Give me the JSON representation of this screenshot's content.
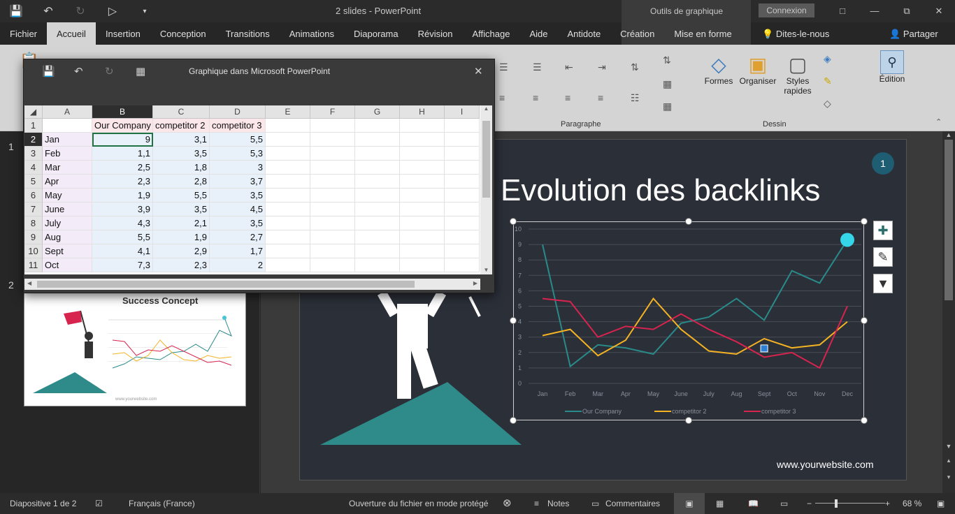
{
  "app": {
    "title": "2 slides  -  PowerPoint",
    "contextual_label": "Outils de graphique",
    "signin_label": "Connexion",
    "tell_me": "Dites-le-nous",
    "share_label": "Partager"
  },
  "tabs": [
    "Fichier",
    "Accueil",
    "Insertion",
    "Conception",
    "Transitions",
    "Animations",
    "Diaporama",
    "Révision",
    "Affichage",
    "Aide",
    "Antidote",
    "Création",
    "Mise en forme"
  ],
  "ribbon": {
    "group_paragraphe": "Paragraphe",
    "group_dessin": "Dessin",
    "formes": "Formes",
    "organiser": "Organiser",
    "styles_rapides": "Styles rapides",
    "edition": "Édition"
  },
  "sheet_window": {
    "title": "Graphique dans Microsoft PowerPoint",
    "columns": [
      "A",
      "B",
      "C",
      "D",
      "E",
      "F",
      "G",
      "H",
      "I"
    ],
    "rows": [
      "1",
      "2",
      "3",
      "4",
      "5",
      "6",
      "7",
      "8",
      "9",
      "10",
      "11"
    ],
    "header_row": [
      "",
      "Our Company",
      "competitor 2",
      "competitor 3"
    ],
    "data": [
      [
        "Jan",
        "9",
        "3,1",
        "5,5"
      ],
      [
        "Feb",
        "1,1",
        "3,5",
        "5,3"
      ],
      [
        "Mar",
        "2,5",
        "1,8",
        "3"
      ],
      [
        "Apr",
        "2,3",
        "2,8",
        "3,7"
      ],
      [
        "May",
        "1,9",
        "5,5",
        "3,5"
      ],
      [
        "June",
        "3,9",
        "3,5",
        "4,5"
      ],
      [
        "July",
        "4,3",
        "2,1",
        "3,5"
      ],
      [
        "Aug",
        "5,5",
        "1,9",
        "2,7"
      ],
      [
        "Sept",
        "4,1",
        "2,9",
        "1,7"
      ],
      [
        "Oct",
        "7,3",
        "2,3",
        "2"
      ]
    ]
  },
  "slide": {
    "badge": "1",
    "url": "www.yourwebsite.com"
  },
  "thumbs": {
    "num1": "1",
    "num2": "2",
    "title2": "Success Concept",
    "url2": "www.yourwebsite.com"
  },
  "statusbar": {
    "slide_count": "Diapositive 1 de 2",
    "language": "Français (France)",
    "protected": "Ouverture du fichier en mode protégé",
    "notes": "Notes",
    "comments": "Commentaires",
    "zoom": "68 %"
  },
  "chart_data": {
    "type": "line",
    "title": "Evolution des backlinks",
    "categories": [
      "Jan",
      "Feb",
      "Mar",
      "Apr",
      "May",
      "June",
      "July",
      "Aug",
      "Sept",
      "Oct",
      "Nov",
      "Dec"
    ],
    "ylim": [
      0,
      10
    ],
    "yticks": [
      0,
      1,
      2,
      3,
      4,
      5,
      6,
      7,
      8,
      9,
      10
    ],
    "grid": true,
    "legend": "bottom",
    "series": [
      {
        "name": "Our Company",
        "color": "#2a8a8a",
        "values": [
          9,
          1.1,
          2.5,
          2.3,
          1.9,
          3.9,
          4.3,
          5.5,
          4.1,
          7.3,
          6.5,
          9.3
        ]
      },
      {
        "name": "competitor 2",
        "color": "#f5b324",
        "values": [
          3.1,
          3.5,
          1.8,
          2.8,
          5.5,
          3.5,
          2.1,
          1.9,
          2.9,
          2.3,
          2.5,
          4
        ]
      },
      {
        "name": "competitor 3",
        "color": "#d6244f",
        "values": [
          5.5,
          5.3,
          3,
          3.7,
          3.5,
          4.5,
          3.5,
          2.7,
          1.7,
          2,
          1,
          5
        ]
      }
    ]
  }
}
